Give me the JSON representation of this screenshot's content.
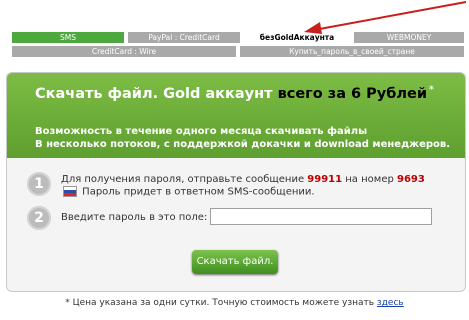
{
  "tabs_top": [
    {
      "label": "SMS",
      "style": "green"
    },
    {
      "label": "PayPal : CreditCard",
      "style": "gray"
    },
    {
      "label": "безGoldАккаунта",
      "style": "active"
    },
    {
      "label": "WEBMONEY",
      "style": "gray"
    }
  ],
  "tabs_bottom": [
    {
      "label": "CreditCard : Wire",
      "style": "gray"
    },
    {
      "label": "Купить_пароль_в_своей_стране",
      "style": "gray"
    }
  ],
  "banner": {
    "title_part1": "Скачать файл. Gold аккаунт ",
    "title_part2": "всего за 6 Рублей",
    "title_star": "*",
    "desc_line1": "Возможность в течение одного месяца скачивать файлы",
    "desc_line2": "В несколько потоков, с поддержкой докачки и download менеджеров."
  },
  "step1": {
    "number": "1",
    "text_a": "Для получения пароля, отправьте сообщение ",
    "code": "99911",
    "text_b": " на номер ",
    "phone": "9693",
    "text_c": " Пароль придет в ответном SMS-сообщении."
  },
  "step2": {
    "number": "2",
    "label": "Введите пароль в это поле:"
  },
  "submit_label": "Скачать файл.",
  "footnote": {
    "text": "* Цена указана за одни сутки. Точную стоимость можете узнать ",
    "link": "здесь"
  },
  "colors": {
    "accent_green": "#5e9f2f",
    "arrow_red": "#c81e1e"
  }
}
